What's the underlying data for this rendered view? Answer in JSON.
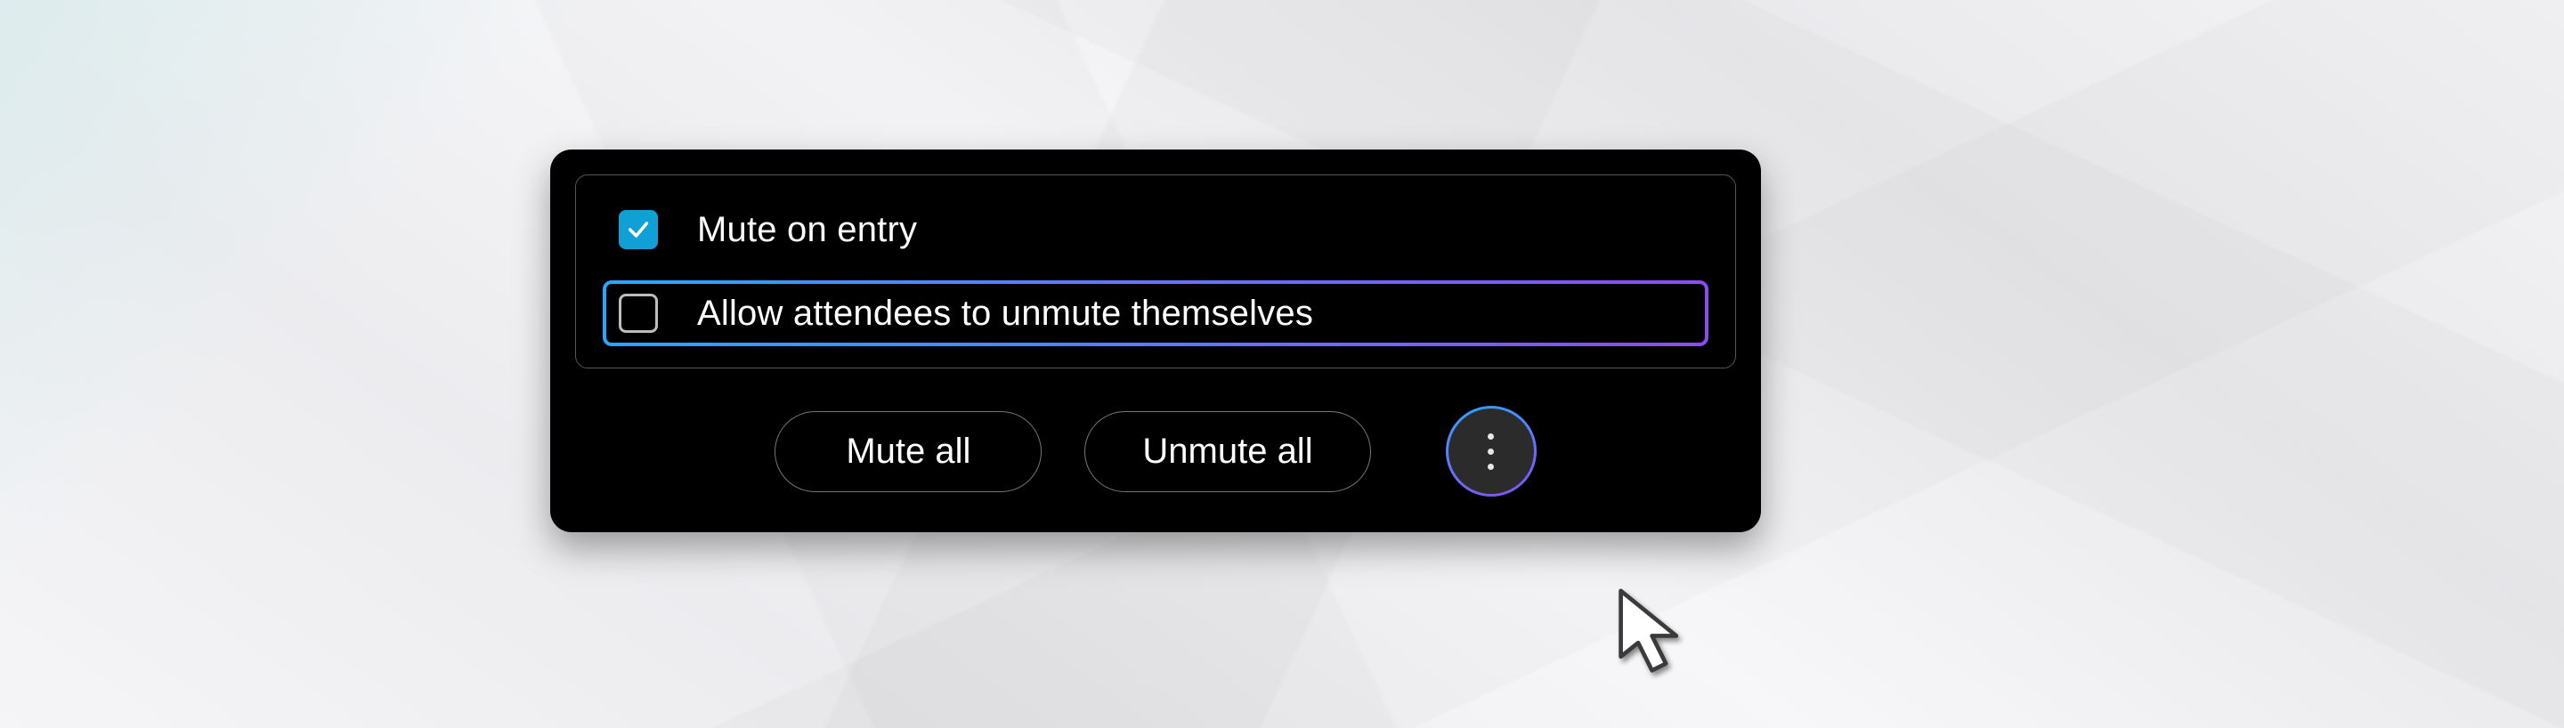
{
  "popup": {
    "options": [
      {
        "label": "Mute  on entry",
        "checked": true,
        "highlighted": false
      },
      {
        "label": "Allow attendees to unmute themselves",
        "checked": false,
        "highlighted": true
      }
    ],
    "buttons": {
      "mute_all_label": "Mute all",
      "unmute_all_label": "Unmute all"
    },
    "more_button_name": "more-options"
  },
  "colors": {
    "checkbox_checked_bg": "#10a0d6",
    "highlight_gradient_start": "#2aa6ff",
    "highlight_gradient_end": "#8a4cf0",
    "panel_bg": "#000000"
  }
}
